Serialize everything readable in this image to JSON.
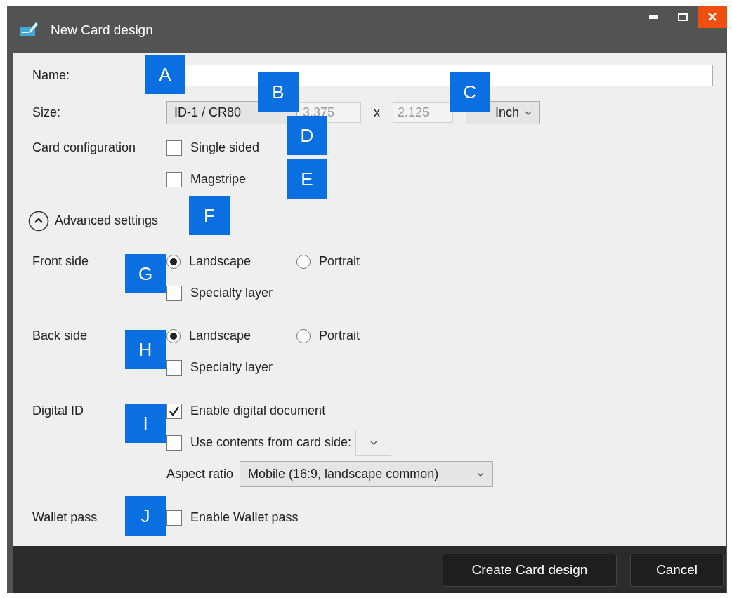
{
  "window": {
    "title": "New Card design"
  },
  "name": {
    "label": "Name:"
  },
  "size": {
    "label": "Size:",
    "preset": "ID-1 / CR80",
    "width": {
      "value": "3.375",
      "disabled": true
    },
    "separator": "x",
    "height": {
      "value": "2.125",
      "disabled": true
    },
    "unit": "Inch"
  },
  "card_configuration": {
    "label": "Card configuration",
    "options": [
      {
        "label": "Single sided",
        "checked": false
      },
      {
        "label": "Magstripe",
        "checked": false
      }
    ]
  },
  "advanced_settings": {
    "label": "Advanced settings",
    "expanded": true
  },
  "sides": [
    {
      "label": "Front side",
      "orientations": [
        {
          "label": "Landscape",
          "selected": true
        },
        {
          "label": "Portrait",
          "selected": false
        }
      ],
      "specialty_layer": {
        "label": "Specialty layer",
        "checked": false
      }
    },
    {
      "label": "Back side",
      "orientations": [
        {
          "label": "Landscape",
          "selected": true
        },
        {
          "label": "Portrait",
          "selected": false
        }
      ],
      "specialty_layer": {
        "label": "Specialty layer",
        "checked": false
      }
    }
  ],
  "digital_id": {
    "label": "Digital ID",
    "enable": {
      "label": "Enable digital document",
      "checked": true
    },
    "use_contents": {
      "label": "Use contents from card side:",
      "checked": false
    },
    "aspect_ratio": {
      "label": "Aspect ratio",
      "value": "Mobile (16:9, landscape common)"
    }
  },
  "wallet_pass": {
    "label": "Wallet pass",
    "enable": {
      "label": "Enable Wallet pass",
      "checked": false
    }
  },
  "buttons": [
    "Create Card design",
    "Cancel"
  ],
  "callouts": [
    "A",
    "B",
    "C",
    "D",
    "E",
    "F",
    "G",
    "H",
    "I",
    "J"
  ]
}
